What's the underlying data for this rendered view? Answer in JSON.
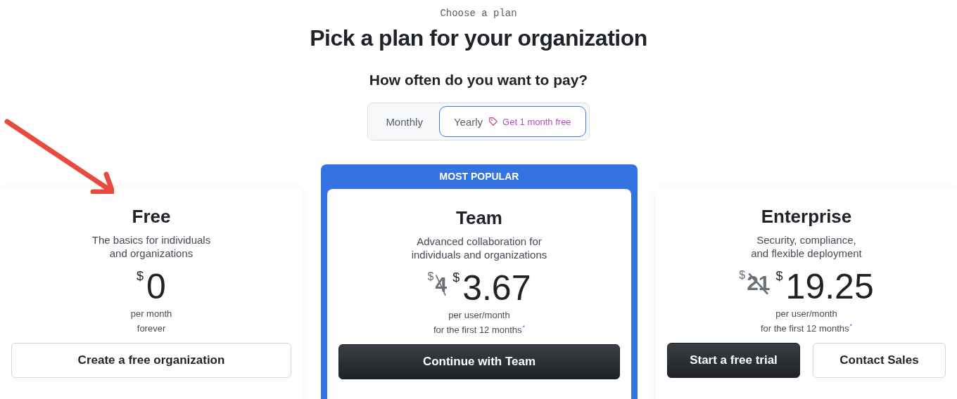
{
  "eyebrow": "Choose a plan",
  "title": "Pick a plan for your organization",
  "billing": {
    "question": "How often do you want to pay?",
    "options": [
      {
        "label": "Monthly",
        "selected": false
      },
      {
        "label": "Yearly",
        "selected": true,
        "promo": "Get 1 month free"
      }
    ]
  },
  "plans": [
    {
      "name": "Free",
      "featured": false,
      "description": [
        "The basics for individuals",
        "and organizations"
      ],
      "currency": "$",
      "price": "0",
      "unit": "per month",
      "term": "forever",
      "buttons": [
        {
          "label": "Create a free organization",
          "primary": false
        }
      ]
    },
    {
      "name": "Team",
      "featured": true,
      "badge": "MOST POPULAR",
      "description": [
        "Advanced collaboration for",
        "individuals and organizations"
      ],
      "old_price": "4",
      "currency": "$",
      "price": "3.67",
      "unit": "per user/month",
      "term": "for the first 12 months$^{*}$",
      "buttons": [
        {
          "label": "Continue with Team",
          "primary": true
        }
      ]
    },
    {
      "name": "Enterprise",
      "featured": false,
      "description": [
        "Security, compliance,",
        "and flexible deployment"
      ],
      "old_price": "21",
      "currency": "$",
      "price": "19.25",
      "unit": "per user/month",
      "term": "for the first 12 months$^{*}$",
      "buttons": [
        {
          "label": "Start a free trial",
          "primary": true
        },
        {
          "label": "Contact Sales",
          "primary": false
        }
      ]
    }
  ],
  "annotation": {
    "kind": "arrow"
  }
}
